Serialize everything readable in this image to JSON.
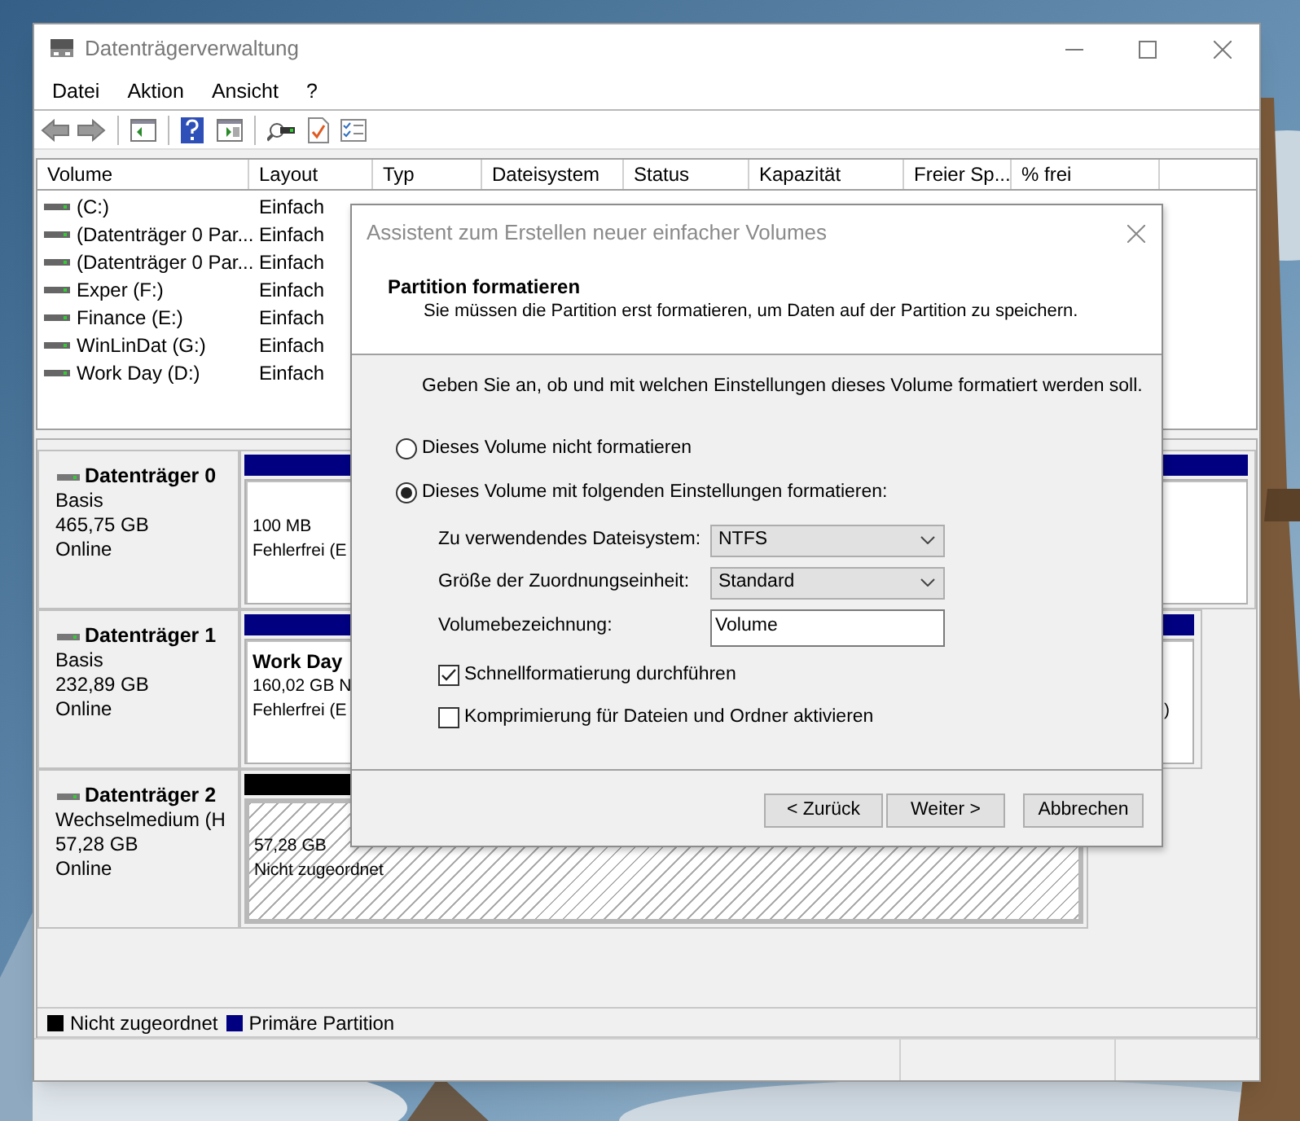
{
  "window": {
    "title": "Datenträgerverwaltung"
  },
  "menu": [
    "Datei",
    "Aktion",
    "Ansicht",
    "?"
  ],
  "volume_table": {
    "columns": [
      "Volume",
      "Layout",
      "Typ",
      "Dateisystem",
      "Status",
      "Kapazität",
      "Freier Sp...",
      "% frei"
    ],
    "rows": [
      {
        "cells": [
          "(C:)",
          "Einfach"
        ]
      },
      {
        "cells": [
          "(Datenträger 0 Par...",
          "Einfach"
        ]
      },
      {
        "cells": [
          "(Datenträger 0 Par...",
          "Einfach"
        ]
      },
      {
        "cells": [
          "Exper (F:)",
          "Einfach"
        ]
      },
      {
        "cells": [
          "Finance (E:)",
          "Einfach"
        ]
      },
      {
        "cells": [
          "WinLinDat (G:)",
          "Einfach"
        ]
      },
      {
        "cells": [
          "Work Day (D:)",
          "Einfach"
        ]
      }
    ]
  },
  "disks": [
    {
      "name": "Datenträger 0",
      "type": "Basis",
      "size": "465,75 GB",
      "status": "Online",
      "partitions": [
        {
          "kind": "primary",
          "lines": [
            "100 MB",
            "Fehlerfrei (E"
          ]
        },
        {
          "kind": "primary"
        }
      ]
    },
    {
      "name": "Datenträger 1",
      "type": "Basis",
      "size": "232,89 GB",
      "status": "Online",
      "partitions": [
        {
          "kind": "primary",
          "name": "Work Day",
          "lines": [
            "160,02 GB N",
            "Fehlerfrei (E"
          ]
        },
        {
          "kind": "primary",
          "lines": [
            ")"
          ]
        }
      ]
    },
    {
      "name": "Datenträger 2",
      "type": "Wechselmedium (H",
      "size": "57,28 GB",
      "status": "Online",
      "partitions": [
        {
          "kind": "unallocated",
          "lines": [
            "57,28 GB",
            "Nicht zugeordnet"
          ]
        }
      ]
    }
  ],
  "legend": [
    {
      "label": "Nicht zugeordnet",
      "color": "#000000"
    },
    {
      "label": "Primäre Partition",
      "color": "#000080"
    }
  ],
  "dialog": {
    "title": "Assistent zum Erstellen neuer einfacher Volumes",
    "heading": "Partition formatieren",
    "subtitle": "Sie müssen die Partition erst formatieren, um Daten auf der Partition zu speichern.",
    "instruction": "Geben Sie an, ob und mit welchen Einstellungen dieses Volume formatiert werden soll.",
    "options": [
      {
        "label": "Dieses Volume nicht formatieren",
        "selected": false
      },
      {
        "label": "Dieses Volume mit folgenden Einstellungen formatieren:",
        "selected": true
      }
    ],
    "fields": [
      {
        "kind": "select",
        "label": "Zu verwendendes Dateisystem:",
        "value": "NTFS"
      },
      {
        "kind": "select",
        "label": "Größe der Zuordnungseinheit:",
        "value": "Standard"
      },
      {
        "kind": "text",
        "label": "Volumebezeichnung:",
        "value": "Volume"
      }
    ],
    "checkboxes": [
      {
        "label": "Schnellformatierung durchführen",
        "checked": true
      },
      {
        "label": "Komprimierung für Dateien und Ordner aktivieren",
        "checked": false
      }
    ],
    "buttons": [
      "< Zurück",
      "Weiter >",
      "Abbrechen"
    ]
  }
}
